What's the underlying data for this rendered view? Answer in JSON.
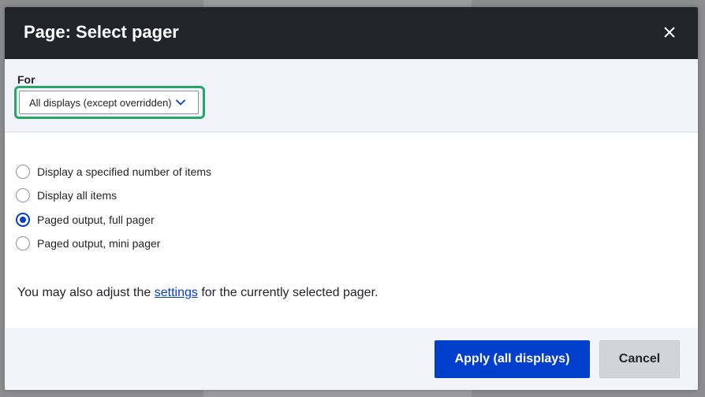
{
  "dialog": {
    "title": "Page: Select pager",
    "close_icon": "close-icon"
  },
  "for_section": {
    "label": "For",
    "select_value": "All displays (except overridden)",
    "chevron_icon": "chevron-down-icon"
  },
  "pager_options": [
    {
      "label": "Display a specified number of items",
      "checked": false
    },
    {
      "label": "Display all items",
      "checked": false
    },
    {
      "label": "Paged output, full pager",
      "checked": true
    },
    {
      "label": "Paged output, mini pager",
      "checked": false
    }
  ],
  "note": {
    "before": "You may also adjust the ",
    "link": "settings",
    "after": " for the currently selected pager."
  },
  "buttons": {
    "apply": "Apply (all displays)",
    "cancel": "Cancel"
  },
  "colors": {
    "accent": "#003ecc",
    "titlebar": "#232429",
    "focus_ring": "#26a769"
  }
}
